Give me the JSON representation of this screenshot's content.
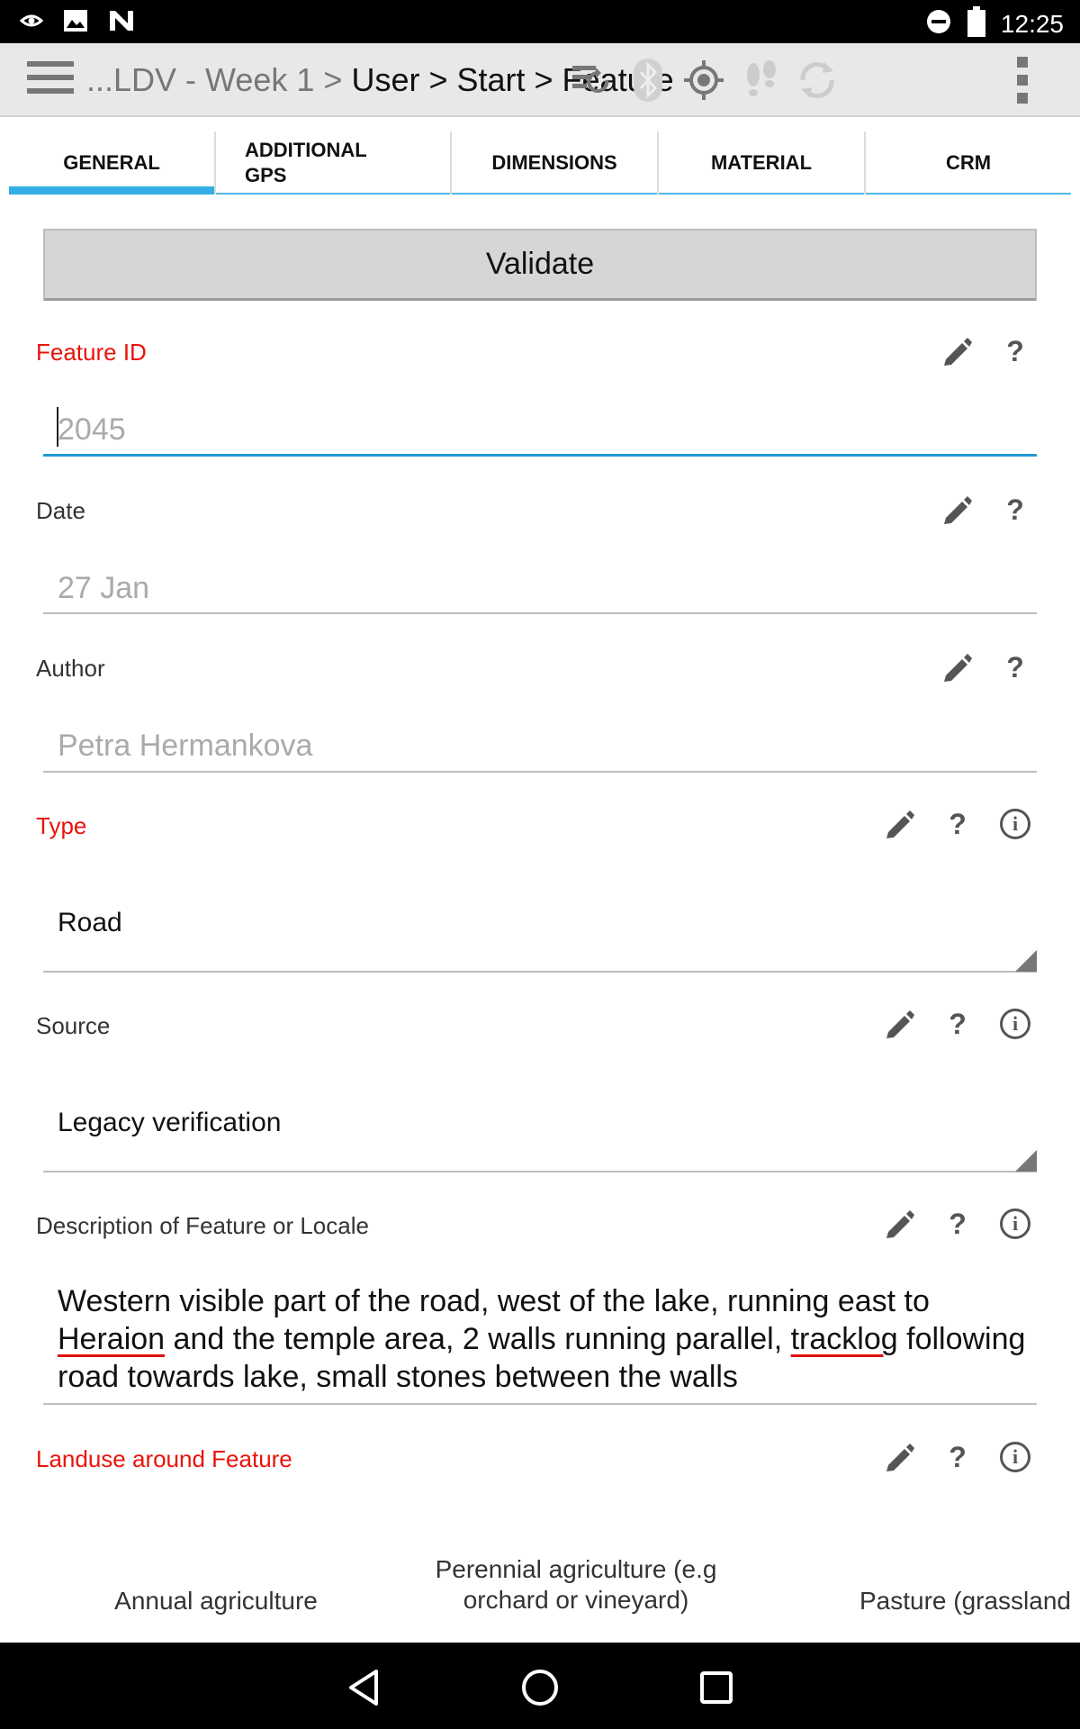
{
  "status_bar": {
    "time": "12:25",
    "left_icons": [
      "eye-icon",
      "image-icon",
      "n-logo-icon"
    ],
    "right_icons": [
      "do-not-disturb-icon",
      "battery-icon"
    ]
  },
  "toolbar": {
    "breadcrumb_prefix": "...LDV - Week 1 > ",
    "breadcrumb_rest": "User > Start > Feature",
    "icons": [
      "sync-icon",
      "bluetooth-icon",
      "gps-icon",
      "tracklog-icon",
      "refresh-icon",
      "overflow-menu-icon"
    ]
  },
  "tabs": [
    {
      "label": "GENERAL",
      "active": true
    },
    {
      "label": "ADDITIONAL\nGPS",
      "active": false
    },
    {
      "label": "DIMENSIONS",
      "active": false
    },
    {
      "label": "MATERIAL",
      "active": false
    },
    {
      "label": "CRM",
      "active": false
    }
  ],
  "validate_label": "Validate",
  "fields": {
    "feature_id": {
      "label": "Feature ID",
      "value": "2045"
    },
    "date": {
      "label": "Date",
      "value": "27 Jan"
    },
    "author": {
      "label": "Author",
      "value": "Petra Hermankova"
    },
    "type": {
      "label": "Type",
      "value": "Road"
    },
    "source": {
      "label": "Source",
      "value": "Legacy verification"
    },
    "description": {
      "label": "Description of Feature or Locale",
      "part1": "Western visible part of the road, west of the lake, running east to ",
      "word1": "Heraion",
      "part2": " and the temple area, 2 walls running parallel, ",
      "word2": "tracklog",
      "part3": " following road towards lake, small stones between the walls"
    },
    "landuse": {
      "label": "Landuse around Feature",
      "options": [
        "Annual agriculture",
        "Perennial agriculture (e.g orchard or vineyard)",
        "Pasture (grassland"
      ]
    }
  },
  "colors": {
    "required": "#e8140a",
    "accent": "#35aee6",
    "focus": "#1e9bd7"
  }
}
